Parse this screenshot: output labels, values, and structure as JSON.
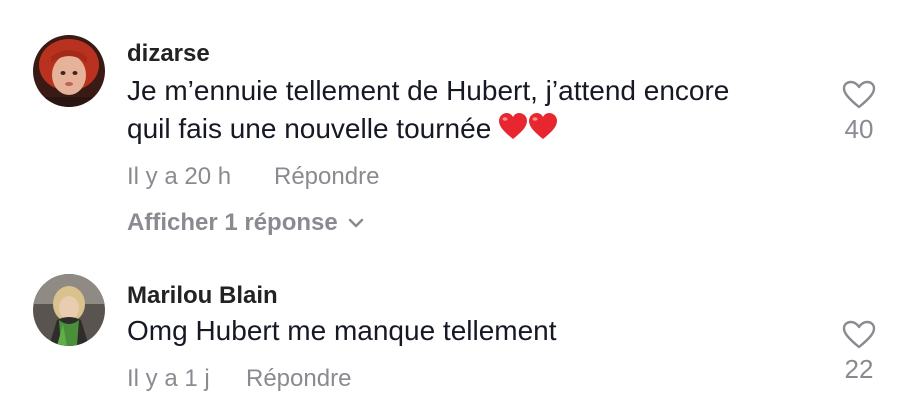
{
  "comments": [
    {
      "username": "dizarse",
      "text_line1": "Je m’ennuie tellement de Hubert, j’attend encore",
      "text_line2": "quil fais une nouvelle tournée",
      "emoji": "❤️❤️",
      "time": "Il y a 20 h",
      "reply_label": "Répondre",
      "view_replies": "Afficher 1 réponse",
      "likes": "40",
      "avatar_icon": "avatar-red-hair"
    },
    {
      "username": "Marilou Blain",
      "text_line1": "Omg Hubert me manque tellement",
      "time": "Il y a 1 j",
      "reply_label": "Répondre",
      "likes": "22",
      "avatar_icon": "avatar-green-scarf"
    }
  ],
  "icons": {
    "like": "heart-outline-icon",
    "expand": "chevron-down-icon"
  },
  "colors": {
    "text": "#161823",
    "secondary": "#8a8b91",
    "heart": "#e8262f"
  }
}
